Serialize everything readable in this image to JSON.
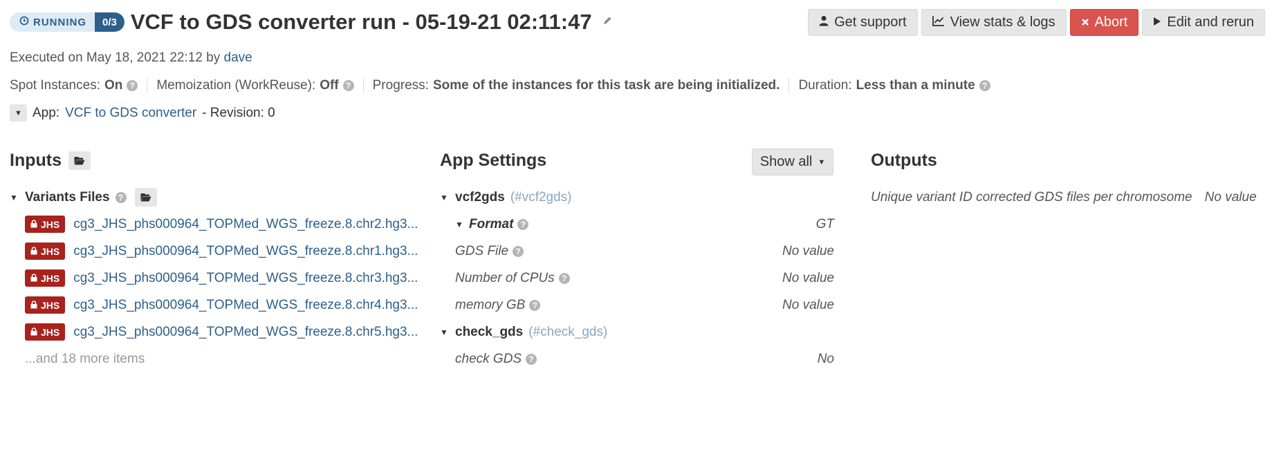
{
  "header": {
    "status": "RUNNING",
    "instances": "0/3",
    "title": "VCF to GDS converter run - 05-19-21 02:11:47"
  },
  "actions": {
    "support": "Get support",
    "stats": "View stats & logs",
    "abort": "Abort",
    "rerun": "Edit and rerun"
  },
  "executed": {
    "prefix": "Executed on May 18, 2021 22:12 by",
    "user": "dave"
  },
  "meta": {
    "spot_label": "Spot Instances:",
    "spot_value": "On",
    "memo_label": "Memoization (WorkReuse):",
    "memo_value": "Off",
    "progress_label": "Progress:",
    "progress_value": "Some of the instances for this task are being initialized.",
    "duration_label": "Duration:",
    "duration_value": "Less than a minute"
  },
  "app": {
    "label": "App:",
    "name": "VCF to GDS converter",
    "revision": "- Revision: 0"
  },
  "inputs": {
    "title": "Inputs",
    "group": "Variants Files",
    "badge": "JHS",
    "files": [
      "cg3_JHS_phs000964_TOPMed_WGS_freeze.8.chr2.hg3...",
      "cg3_JHS_phs000964_TOPMed_WGS_freeze.8.chr1.hg3...",
      "cg3_JHS_phs000964_TOPMed_WGS_freeze.8.chr3.hg3...",
      "cg3_JHS_phs000964_TOPMed_WGS_freeze.8.chr4.hg3...",
      "cg3_JHS_phs000964_TOPMed_WGS_freeze.8.chr5.hg3..."
    ],
    "more": "...and 18 more items"
  },
  "settings": {
    "title": "App Settings",
    "show_all": "Show all",
    "vcf2gds": {
      "name": "vcf2gds",
      "id": "(#vcf2gds)"
    },
    "format": {
      "name": "Format",
      "value": "GT"
    },
    "gds_file": {
      "name": "GDS File",
      "value": "No value"
    },
    "cpus": {
      "name": "Number of CPUs",
      "value": "No value"
    },
    "memory": {
      "name": "memory GB",
      "value": "No value"
    },
    "check_gds_group": {
      "name": "check_gds",
      "id": "(#check_gds)"
    },
    "check_gds": {
      "name": "check GDS",
      "value": "No"
    }
  },
  "outputs": {
    "title": "Outputs",
    "name": "Unique variant ID corrected GDS files per chromosome",
    "value": "No value"
  },
  "icons": {
    "clock": "clock-icon",
    "pencil": "pencil-icon",
    "user": "user-icon",
    "chart": "line-chart-icon",
    "close": "close-icon",
    "play": "play-icon",
    "question": "question-circle-icon",
    "folder": "folder-open-icon",
    "lock": "lock-icon",
    "caret": "caret-down-icon"
  },
  "colors": {
    "link": "#2c5f8a",
    "abort": "#d9534f",
    "badge": "#a8221e",
    "running_bg": "#dcebf6"
  }
}
